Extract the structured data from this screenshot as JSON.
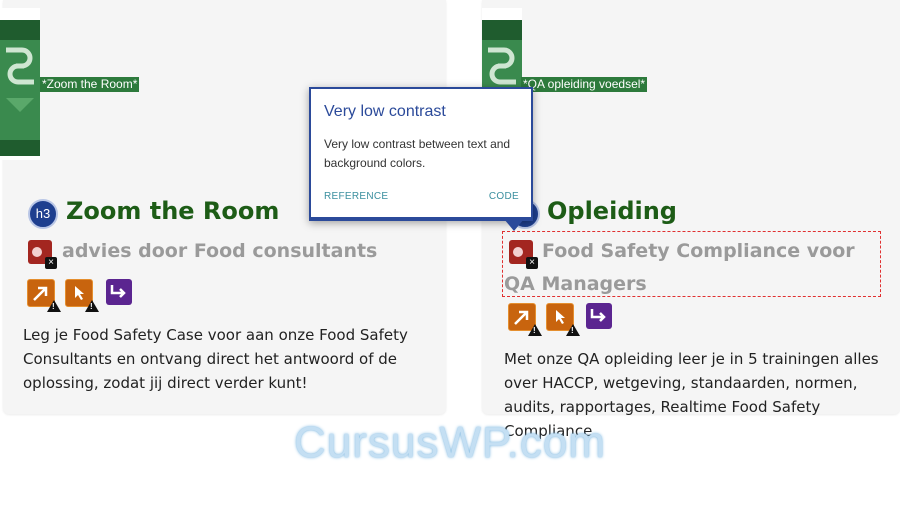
{
  "cards": [
    {
      "image_alt": "*Zoom the Room*",
      "heading_badge": "h3",
      "title": "Zoom the Room",
      "subtitle": "advies door Food consultants",
      "description": "Leg je Food Safety Case voor aan onze Food Safety Consultants en ontvang direct het antwoord of de oplossing, zodat jij direct verder kunt!"
    },
    {
      "image_alt": "*QA opleiding voedsel*",
      "heading_badge": "h3",
      "title": "Opleiding",
      "subtitle": "Food Safety Compliance voor QA Managers",
      "description": "Met onze QA opleiding leer je in 5 trainingen alles over HACCP, wetgeving, standaarden, normen, audits, rapportages, Realtime Food Safety Compliance."
    }
  ],
  "popup": {
    "title": "Very low contrast",
    "body": "Very low contrast between text and background colors.",
    "reference_label": "REFERENCE",
    "code_label": "CODE"
  },
  "watermark": "CursusWP.com",
  "icons": {
    "heading": "h3-badge",
    "contrast_error": "contrast-error-icon",
    "tab_order": "tab-order-icon",
    "click_alert": "click-alert-icon",
    "redirect": "redirect-icon"
  },
  "colors": {
    "title_green": "#1d5c16",
    "low_contrast_grey": "#9a9a9a",
    "popup_blue": "#2b4a9a",
    "error_red": "#a32620",
    "alert_orange": "#c8640e",
    "redirect_purple": "#5b2590"
  }
}
